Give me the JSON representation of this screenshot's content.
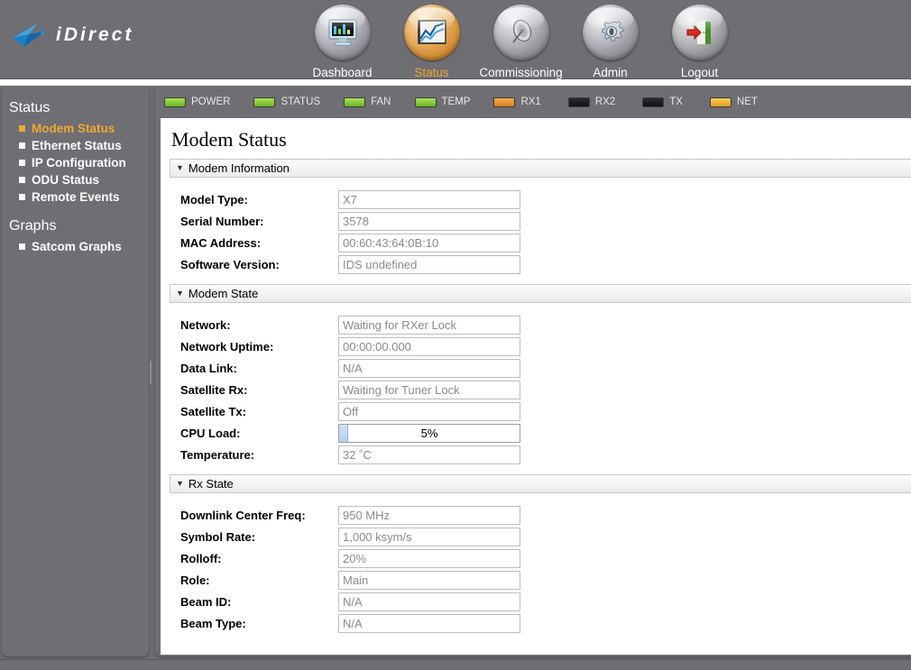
{
  "brand": {
    "name": "iDirect",
    "logo_icon": "idirect-arrow-logo"
  },
  "nav": [
    {
      "label": "Dashboard",
      "icon": "monitor-chart-icon",
      "active": false
    },
    {
      "label": "Status",
      "icon": "line-chart-icon",
      "active": true
    },
    {
      "label": "Commissioning",
      "icon": "satellite-dish-icon",
      "active": false
    },
    {
      "label": "Admin",
      "icon": "gear-icon",
      "active": false
    },
    {
      "label": "Logout",
      "icon": "exit-door-icon",
      "active": false
    }
  ],
  "sidebar": {
    "groups": [
      {
        "title": "Status",
        "items": [
          {
            "label": "Modem Status",
            "active": true
          },
          {
            "label": "Ethernet Status",
            "active": false
          },
          {
            "label": "IP Configuration",
            "active": false
          },
          {
            "label": "ODU Status",
            "active": false
          },
          {
            "label": "Remote Events",
            "active": false
          }
        ]
      },
      {
        "title": "Graphs",
        "items": [
          {
            "label": "Satcom Graphs",
            "active": false
          }
        ]
      }
    ]
  },
  "leds": [
    {
      "name": "POWER",
      "state": "green"
    },
    {
      "name": "STATUS",
      "state": "green"
    },
    {
      "name": "FAN",
      "state": "green"
    },
    {
      "name": "TEMP",
      "state": "green"
    },
    {
      "name": "RX1",
      "state": "orange"
    },
    {
      "name": "RX2",
      "state": "off"
    },
    {
      "name": "TX",
      "state": "off"
    },
    {
      "name": "NET",
      "state": "amber"
    }
  ],
  "page": {
    "title": "Modem Status"
  },
  "sections": [
    {
      "title": "Modem Information",
      "expanded": true,
      "fields": [
        {
          "label": "Model Type:",
          "value": "X7"
        },
        {
          "label": "Serial Number:",
          "value": "3578"
        },
        {
          "label": "MAC Address:",
          "value": "00:60:43:64:0B:10"
        },
        {
          "label": "Software Version:",
          "value": "IDS undefined"
        }
      ]
    },
    {
      "title": "Modem State",
      "expanded": true,
      "fields": [
        {
          "label": "Network:",
          "value": "Waiting for RXer Lock"
        },
        {
          "label": "Network Uptime:",
          "value": "00:00:00.000"
        },
        {
          "label": "Data Link:",
          "value": "N/A"
        },
        {
          "label": "Satellite Rx:",
          "value": "Waiting for Tuner Lock"
        },
        {
          "label": "Satellite Tx:",
          "value": "Off"
        },
        {
          "label": "CPU Load:",
          "value": "5%",
          "type": "progress",
          "percent": 5
        },
        {
          "label": "Temperature:",
          "value": "32 ˚C"
        }
      ]
    },
    {
      "title": "Rx State",
      "expanded": true,
      "fields": [
        {
          "label": "Downlink Center Freq:",
          "value": "950 MHz"
        },
        {
          "label": "Symbol Rate:",
          "value": "1,000 ksym/s"
        },
        {
          "label": "Rolloff:",
          "value": "20%"
        },
        {
          "label": "Role:",
          "value": "Main"
        },
        {
          "label": "Beam ID:",
          "value": "N/A"
        },
        {
          "label": "Beam Type:",
          "value": "N/A"
        }
      ]
    }
  ],
  "colors": {
    "chrome": "#6e6e73",
    "accent": "#f0a830",
    "led_green": "#7ec32a",
    "led_orange": "#dd7f16",
    "led_amber": "#e0a31c",
    "progress_fill": "#bcd7f0"
  }
}
